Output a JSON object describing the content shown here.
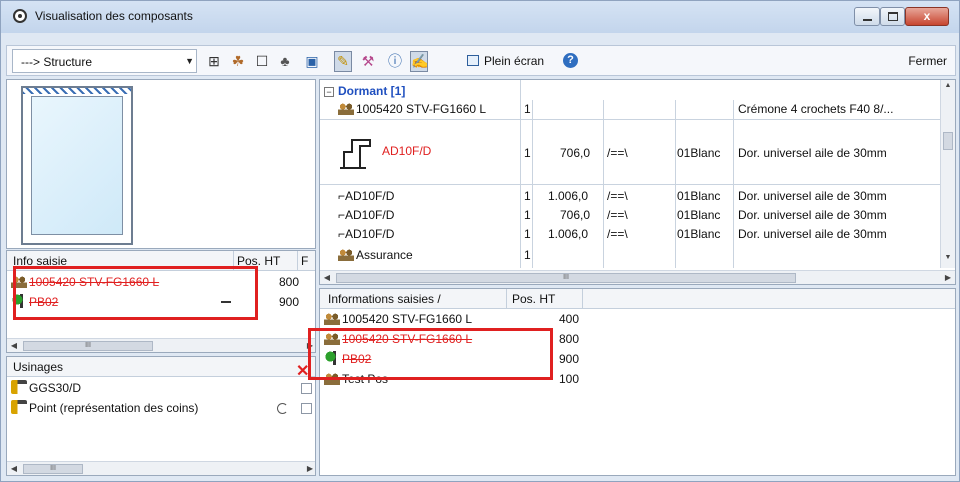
{
  "window": {
    "title": "Visualisation des composants",
    "close_glyph": "x"
  },
  "toolbar": {
    "combo_value": "---> Structure",
    "plein_ecran": "Plein écran",
    "help": "?",
    "fermer": "Fermer",
    "icons": [
      "align-icon",
      "people-icon",
      "square-icon",
      "group-icon",
      "screen-icon",
      "drill-icon",
      "tool-icon",
      "info-icon",
      "paint-icon"
    ]
  },
  "info_saisie_left": {
    "headers": [
      "Info saisie",
      "Pos. HT",
      "F"
    ],
    "rows": [
      {
        "label": "1005420 STV-FG1660 L",
        "pos": "800",
        "icon": "people-icon"
      },
      {
        "label": "PB02",
        "pos": "900",
        "icon": "green-icon"
      }
    ],
    "scroll_thumb": "III"
  },
  "usinages": {
    "header": "Usinages",
    "rows": [
      {
        "label": "GGS30/D"
      },
      {
        "label": "Point (représentation des coins)"
      }
    ],
    "scroll_thumb": "III"
  },
  "grid": {
    "group": "Dormant [1]",
    "rows": [
      {
        "label": "1005420 STV-FG1660 L",
        "qty": "1",
        "dim": "",
        "sym": "",
        "color": "",
        "desc": "Crémone 4 crochets F40 8/...",
        "red": false
      },
      {
        "label": "AD10F/D",
        "qty": "1",
        "dim": "706,0",
        "sym": "/==\\",
        "color": "01Blanc",
        "desc": "Dor. universel aile de 30mm",
        "red": true
      },
      {
        "label": "AD10F/D",
        "qty": "1",
        "dim": "1.006,0",
        "sym": "/==\\",
        "color": "01Blanc",
        "desc": "Dor. universel aile de 30mm",
        "red": false
      },
      {
        "label": "AD10F/D",
        "qty": "1",
        "dim": "706,0",
        "sym": "/==\\",
        "color": "01Blanc",
        "desc": "Dor. universel aile de 30mm",
        "red": false
      },
      {
        "label": "AD10F/D",
        "qty": "1",
        "dim": "1.006,0",
        "sym": "/==\\",
        "color": "01Blanc",
        "desc": "Dor. universel aile de 30mm",
        "red": false
      },
      {
        "label": "Assurance",
        "qty": "1",
        "dim": "",
        "sym": "",
        "color": "",
        "desc": "",
        "red": false
      }
    ],
    "scroll_thumb": "III"
  },
  "info_saisie_right": {
    "headers": [
      "Informations saisies /",
      "Pos. HT"
    ],
    "rows": [
      {
        "label": "1005420 STV-FG1660 L",
        "pos": "400",
        "strike": false
      },
      {
        "label": "1005420 STV-FG1660 L",
        "pos": "800",
        "strike": true
      },
      {
        "label": "PB02",
        "pos": "900",
        "strike": true
      },
      {
        "label": "Test Pos",
        "pos": "100",
        "strike": false
      }
    ]
  },
  "colors": {
    "annotation": "#e02020",
    "frame": "#6d7d91"
  }
}
